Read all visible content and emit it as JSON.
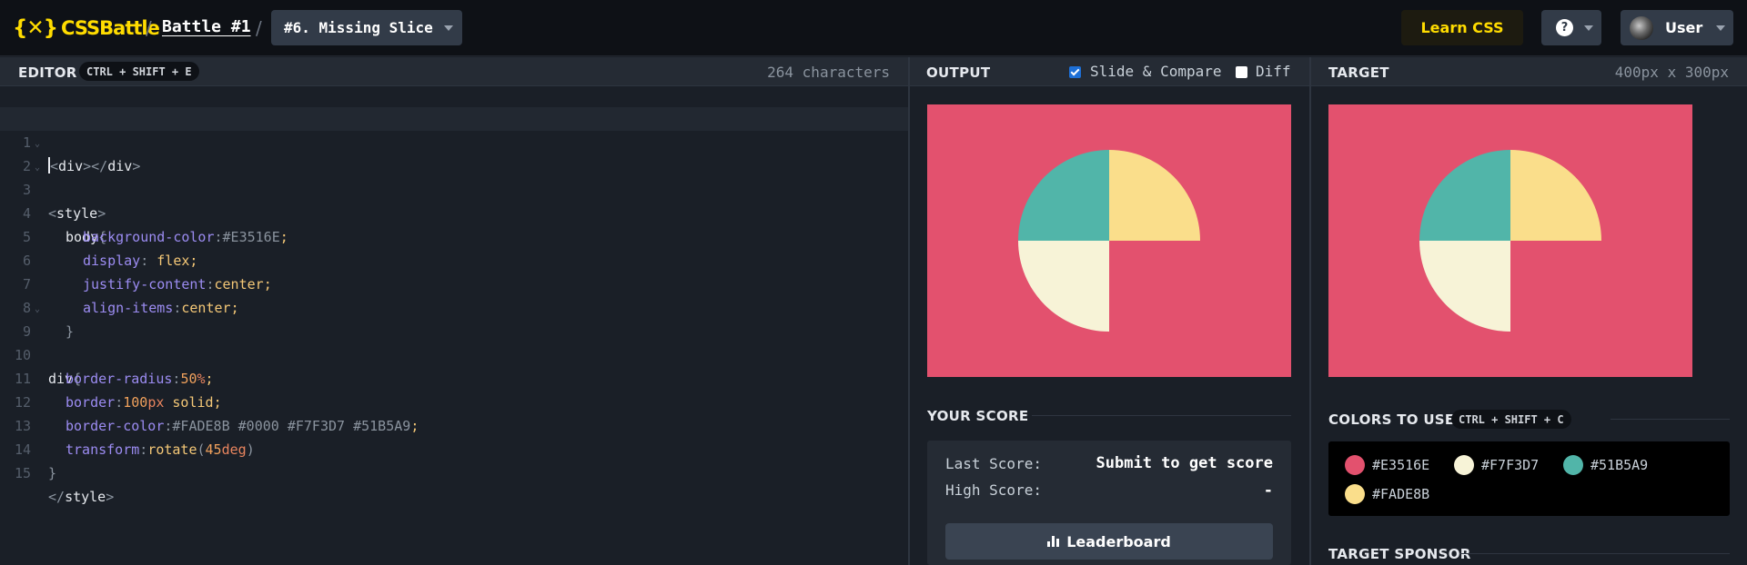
{
  "nav": {
    "logo": "CSSBattle",
    "logo_mark": "{✕}",
    "sep": "/",
    "battle": "Battle #1",
    "level": "#6. Missing Slice",
    "learn": "Learn CSS",
    "help": "?",
    "user": "User"
  },
  "editor": {
    "title": "EDITOR",
    "shortcut": "CTRL + SHIFT + E",
    "chars": "264 characters",
    "lines": [
      "1",
      "2",
      "3",
      "4",
      "5",
      "6",
      "7",
      "8",
      "9",
      "10",
      "11",
      "12",
      "13",
      "14",
      "15"
    ]
  },
  "code": {
    "l1": [
      "<",
      "div",
      "></",
      "div",
      ">"
    ],
    "l2": [
      "<",
      "style",
      ">"
    ],
    "l3": [
      "body",
      "{"
    ],
    "l4": [
      "background-color",
      ":",
      "#E3516E",
      ";"
    ],
    "l5": [
      "display",
      ": ",
      "flex",
      ";"
    ],
    "l6": [
      "justify-content",
      ":",
      "center",
      ";"
    ],
    "l7": [
      "align-items",
      ":",
      "center",
      ";"
    ],
    "l8": [
      "}"
    ],
    "l9": [
      "div",
      "{"
    ],
    "l10": [
      "border-radius",
      ":",
      "50",
      "%",
      ";"
    ],
    "l11": [
      "border",
      ":",
      "100",
      "px",
      " solid",
      ";"
    ],
    "l12": [
      "border-color",
      ":",
      "#FADE8B #0000 #F7F3D7 #51B5A9",
      ";"
    ],
    "l13": [
      "transform",
      ":",
      "rotate",
      "(",
      "45",
      "deg",
      ")"
    ],
    "l14": [
      "}"
    ],
    "l15": [
      "</",
      "style",
      ">"
    ]
  },
  "output": {
    "title": "OUTPUT",
    "slide_compare": "Slide & Compare",
    "diff": "Diff"
  },
  "target": {
    "title": "TARGET",
    "size": "400px x 300px"
  },
  "score": {
    "title": "YOUR SCORE",
    "last_label": "Last Score:",
    "last_value": "Submit to get score",
    "high_label": "High Score:",
    "high_value": "-",
    "leaderboard": "Leaderboard"
  },
  "colors": {
    "title": "COLORS TO USE",
    "shortcut": "CTRL + SHIFT + C",
    "items": [
      "#E3516E",
      "#F7F3D7",
      "#51B5A9",
      "#FADE8B"
    ]
  },
  "sponsor": {
    "title": "TARGET SPONSOR"
  },
  "palette": {
    "bg": "#E3516E",
    "cream": "#F7F3D7",
    "teal": "#51B5A9",
    "yellow": "#FADE8B"
  }
}
